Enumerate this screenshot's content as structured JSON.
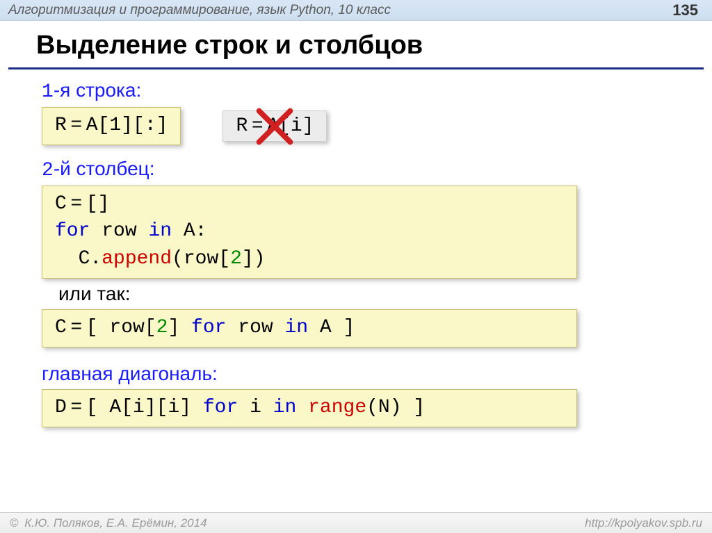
{
  "header": {
    "course": "Алгоритмизация и программирование, язык Python, 10 класс",
    "page": "135"
  },
  "title": "Выделение строк и столбцов",
  "section1": {
    "digit": "1",
    "label_rest": "-я строка:",
    "code_good": "R = A[1][:]",
    "code_bad": "R = A[i]"
  },
  "section2": {
    "digit": "2",
    "label_rest": "-й столбец:",
    "line1_a": "C = []",
    "line2_for": "for",
    "line2_mid": " row ",
    "line2_in": "in",
    "line2_end": " A:",
    "line3_a": "  C.",
    "line3_append": "append",
    "line3_b": "(row[",
    "line3_num": "2",
    "line3_c": "])",
    "or_label": "или так:",
    "alt_a": "C = [ row[",
    "alt_num": "2",
    "alt_b": "] ",
    "alt_for": "for",
    "alt_mid": " row ",
    "alt_in": "in",
    "alt_end": " A ]"
  },
  "section3": {
    "label": "главная диагональ:",
    "d_a": "D = [ A[i][i] ",
    "d_for": "for",
    "d_mid": " i ",
    "d_in": "in",
    "d_sp": " ",
    "d_range": "range",
    "d_end": "(N) ]"
  },
  "footer": {
    "left": " К.Ю. Поляков, Е.А. Ерёмин, 2014",
    "right": "http://kpolyakov.spb.ru"
  }
}
